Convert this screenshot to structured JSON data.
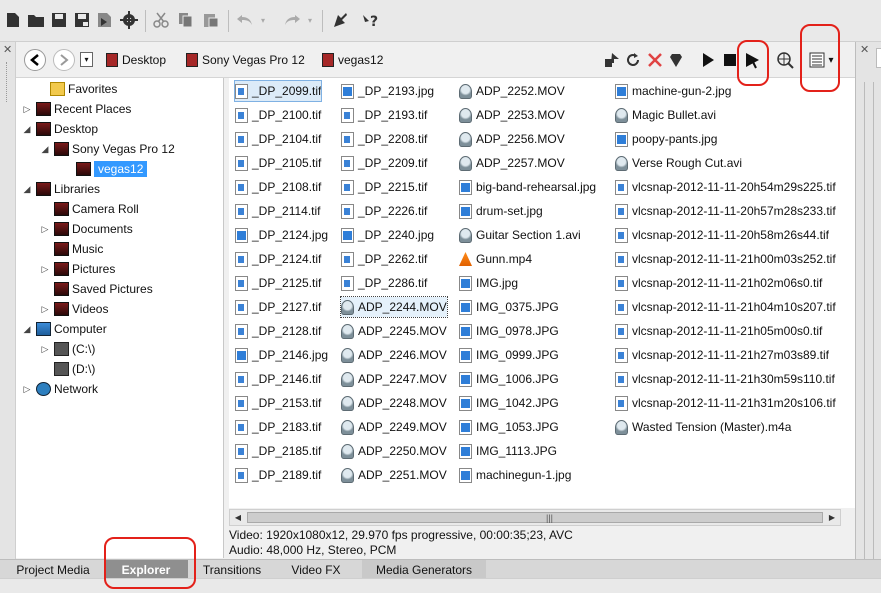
{
  "toolbar": {
    "icons": [
      "new-file-icon",
      "open-folder-icon",
      "save-icon",
      "save-as-icon",
      "render-icon",
      "settings-icon",
      "cut-icon",
      "copy-icon",
      "paste-icon",
      "undo-icon",
      "redo-icon",
      "help-pointer-icon",
      "context-help-icon"
    ]
  },
  "nav": {
    "breadcrumbs": [
      {
        "label": "Desktop"
      },
      {
        "label": "Sony Vegas Pro 12"
      },
      {
        "label": "vegas12"
      }
    ]
  },
  "tree": [
    {
      "label": "Favorites",
      "icon": "star-icon",
      "expander": ""
    },
    {
      "label": "Recent Places",
      "icon": "folder-icon",
      "expander": "▷"
    },
    {
      "label": "Desktop",
      "icon": "folder-icon",
      "expander": "◢"
    },
    {
      "label": "Sony Vegas Pro 12",
      "icon": "folder-icon",
      "expander": "◢"
    },
    {
      "label": "vegas12",
      "icon": "folder-icon",
      "expander": "",
      "selected": true
    },
    {
      "label": "Libraries",
      "icon": "folder-icon",
      "expander": "◢"
    },
    {
      "label": "Camera Roll",
      "icon": "folder-icon",
      "expander": ""
    },
    {
      "label": "Documents",
      "icon": "folder-icon",
      "expander": "▷"
    },
    {
      "label": "Music",
      "icon": "folder-icon",
      "expander": ""
    },
    {
      "label": "Pictures",
      "icon": "folder-icon",
      "expander": "▷"
    },
    {
      "label": "Saved Pictures",
      "icon": "folder-icon",
      "expander": ""
    },
    {
      "label": "Videos",
      "icon": "folder-icon",
      "expander": "▷"
    },
    {
      "label": "Computer",
      "icon": "computer-icon",
      "expander": "◢"
    },
    {
      "label": "(C:\\)",
      "icon": "drive-icon",
      "expander": "▷"
    },
    {
      "label": "(D:\\)",
      "icon": "drive-icon",
      "expander": ""
    },
    {
      "label": "Network",
      "icon": "network-icon",
      "expander": "▷"
    }
  ],
  "files": {
    "col1": [
      "_DP_2099.tif",
      "_DP_2100.tif",
      "_DP_2104.tif",
      "_DP_2105.tif",
      "_DP_2108.tif",
      "_DP_2114.tif",
      "_DP_2124.jpg",
      "_DP_2124.tif",
      "_DP_2125.tif",
      "_DP_2127.tif",
      "_DP_2128.tif",
      "_DP_2146.jpg",
      "_DP_2146.tif",
      "_DP_2153.tif",
      "_DP_2183.tif",
      "_DP_2185.tif",
      "_DP_2189.tif"
    ],
    "col2": [
      "_DP_2193.jpg",
      "_DP_2193.tif",
      "_DP_2208.tif",
      "_DP_2209.tif",
      "_DP_2215.tif",
      "_DP_2226.tif",
      "_DP_2240.jpg",
      "_DP_2262.tif",
      "_DP_2286.tif",
      "ADP_2244.MOV",
      "ADP_2245.MOV",
      "ADP_2246.MOV",
      "ADP_2247.MOV",
      "ADP_2248.MOV",
      "ADP_2249.MOV",
      "ADP_2250.MOV",
      "ADP_2251.MOV"
    ],
    "col3": [
      "ADP_2252.MOV",
      "ADP_2253.MOV",
      "ADP_2256.MOV",
      "ADP_2257.MOV",
      "big-band-rehearsal.jpg",
      "drum-set.jpg",
      "Guitar Section 1.avi",
      "Gunn.mp4",
      "IMG.jpg",
      "IMG_0375.JPG",
      "IMG_0978.JPG",
      "IMG_0999.JPG",
      "IMG_1006.JPG",
      "IMG_1042.JPG",
      "IMG_1053.JPG",
      "IMG_1113.JPG",
      "machinegun-1.jpg"
    ],
    "col4": [
      "machine-gun-2.jpg",
      "Magic Bullet.avi",
      "poopy-pants.jpg",
      "Verse Rough Cut.avi",
      "vlcsnap-2012-11-11-20h54m29s225.tif",
      "vlcsnap-2012-11-11-20h57m28s233.tif",
      "vlcsnap-2012-11-11-20h58m26s44.tif",
      "vlcsnap-2012-11-11-21h00m03s252.tif",
      "vlcsnap-2012-11-11-21h02m06s0.tif",
      "vlcsnap-2012-11-11-21h04m10s207.tif",
      "vlcsnap-2012-11-11-21h05m00s0.tif",
      "vlcsnap-2012-11-11-21h27m03s89.tif",
      "vlcsnap-2012-11-11-21h30m59s110.tif",
      "vlcsnap-2012-11-11-21h31m20s106.tif",
      "Wasted Tension (Master).m4a"
    ],
    "selected": "_DP_2099.tif",
    "focused": "ADP_2244.MOV"
  },
  "info": {
    "video": "Video: 1920x1080x12, 29.970 fps progressive, 00:00:35;23, AVC",
    "audio": "Audio: 48,000 Hz, Stereo, PCM"
  },
  "tabs": [
    {
      "label": "Project Media"
    },
    {
      "label": "Explorer",
      "active": true
    },
    {
      "label": "Transitions"
    },
    {
      "label": "Video FX"
    },
    {
      "label": "Media Generators"
    }
  ],
  "colors": {
    "selection": "#3399ff",
    "annotation": "#e3211a",
    "active_tab": "#8f8f8f"
  }
}
